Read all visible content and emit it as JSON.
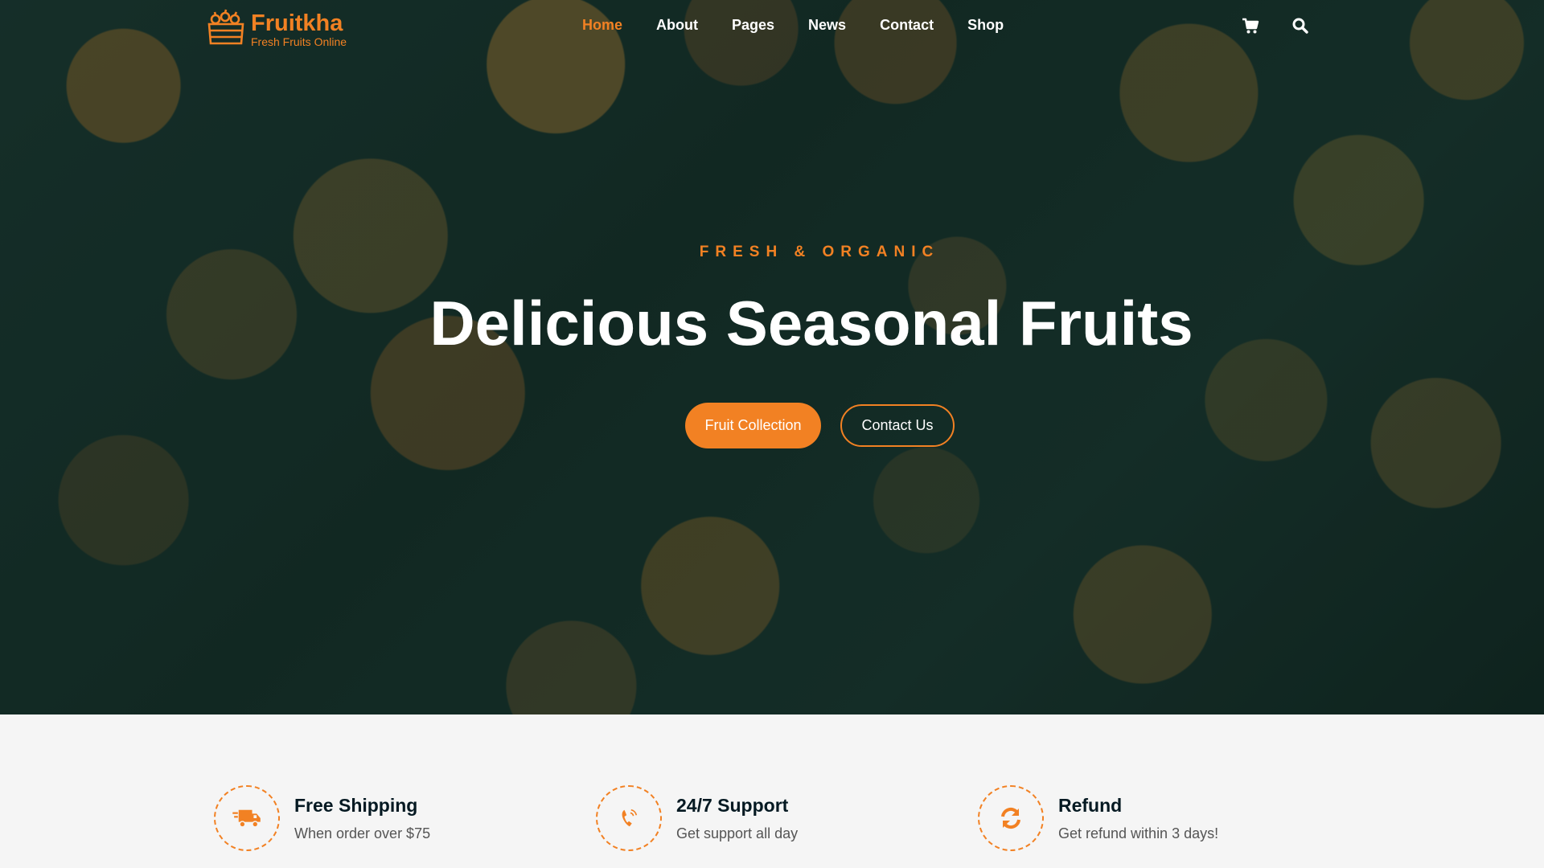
{
  "brand": {
    "name": "Fruitkha",
    "tagline": "Fresh Fruits Online",
    "logo_icon": "fruit-crate-icon",
    "accent_color": "#F28123"
  },
  "nav": {
    "items": [
      {
        "label": "Home",
        "active": true
      },
      {
        "label": "About"
      },
      {
        "label": "Pages"
      },
      {
        "label": "News"
      },
      {
        "label": "Contact"
      },
      {
        "label": "Shop"
      }
    ],
    "icons": [
      "cart-icon",
      "search-icon"
    ]
  },
  "hero": {
    "subtitle": "FRESH & ORGANIC",
    "headline": "Delicious Seasonal Fruits",
    "primary_button": "Fruit Collection",
    "secondary_button": "Contact Us"
  },
  "features": [
    {
      "icon": "shipping-truck-icon",
      "title": "Free Shipping",
      "desc": "When order over $75"
    },
    {
      "icon": "phone-support-icon",
      "title": "24/7 Support",
      "desc": "Get support all day"
    },
    {
      "icon": "refund-sync-icon",
      "title": "Refund",
      "desc": "Get refund within 3 days!"
    }
  ]
}
